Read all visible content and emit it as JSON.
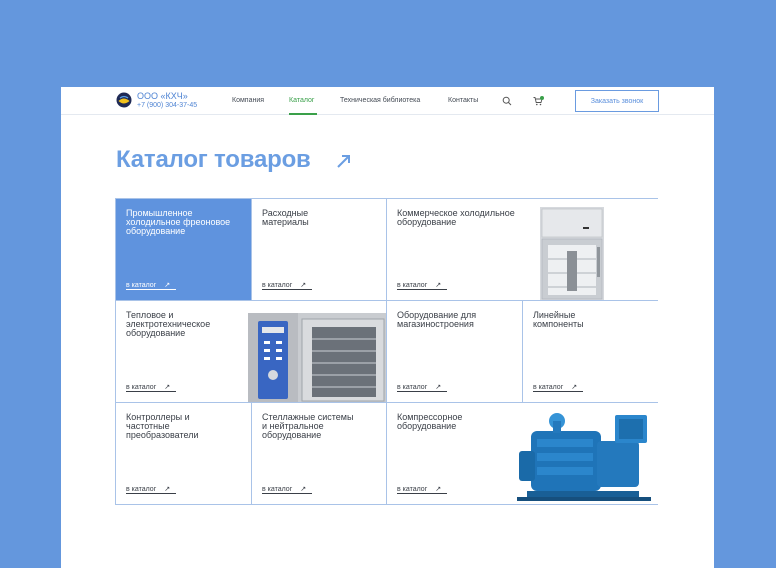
{
  "header": {
    "company_name": "ООО «КХЧ»",
    "phone": "+7 (900) 304-37-45",
    "nav": [
      {
        "label": "Компания",
        "active": false
      },
      {
        "label": "Каталог",
        "active": true
      },
      {
        "label": "Техническая библиотека",
        "active": false
      },
      {
        "label": "Контакты",
        "active": false
      }
    ],
    "icons": [
      "search-icon",
      "cart-icon"
    ],
    "call_button": "Заказать звонок"
  },
  "catalog": {
    "title": "Каталог товаров",
    "title_icon": "arrow-up-right-icon",
    "link_label": "в каталог",
    "items": [
      {
        "title": "Промышленное\nхолодильное фреоновое\nоборудование",
        "highlighted": true
      },
      {
        "title": "Расходные\nматериалы"
      },
      {
        "title": "Коммерческое холодильное\nоборудование",
        "image": "refrigerator-image"
      },
      {
        "title": "Тепловое и\nэлектротехническое\nоборудование",
        "image": "combi-oven-image"
      },
      {
        "title": "Оборудование для\nмагазиностроения"
      },
      {
        "title": "Линейные\nкомпоненты"
      },
      {
        "title": "Контроллеры и\nчастотные\nпреобразователи"
      },
      {
        "title": "Стеллажные системы\nи нейтральное\nоборудование"
      },
      {
        "title": "Компрессорное\nоборудование",
        "image": "compressor-image"
      }
    ]
  },
  "colors": {
    "background": "#6497dd",
    "accent_blue": "#5f93de",
    "nav_active": "#3aa04a"
  }
}
